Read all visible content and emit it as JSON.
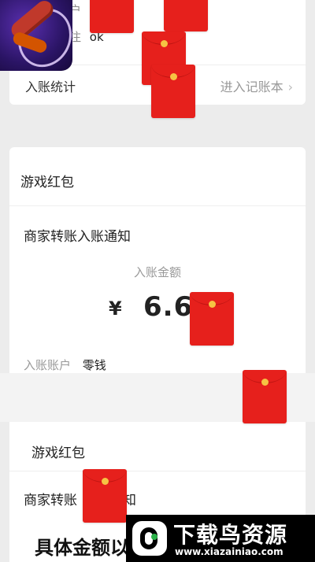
{
  "top_card": {
    "row1": {
      "label": "户",
      "value": ""
    },
    "row2": {
      "label": "注",
      "value": "ok"
    },
    "stat_label": "入账统计",
    "stat_link": "进入记账本",
    "stat_chevron": "›"
  },
  "game_card_1": {
    "title": "游戏红包",
    "notice": "商家转账入账通知",
    "amount_label": "入账金额",
    "currency": "¥",
    "amount": "6.6",
    "account_label": "入账账户",
    "account_value": "零钱"
  },
  "game_card_2": {
    "title": "游戏红包",
    "notice_part1": "商家转账",
    "notice_part2": "知"
  },
  "caption": "具体金额以",
  "watermark": {
    "title": "下载鸟资源",
    "url": "www.xiazainiao.com"
  },
  "colors": {
    "envelope_red": "#e6201c",
    "coin_gold": "#f6c343",
    "background": "#ececec"
  },
  "icons": [
    "app-icon",
    "red-envelope-icon",
    "chevron-right-icon",
    "watermark-logo-icon"
  ]
}
